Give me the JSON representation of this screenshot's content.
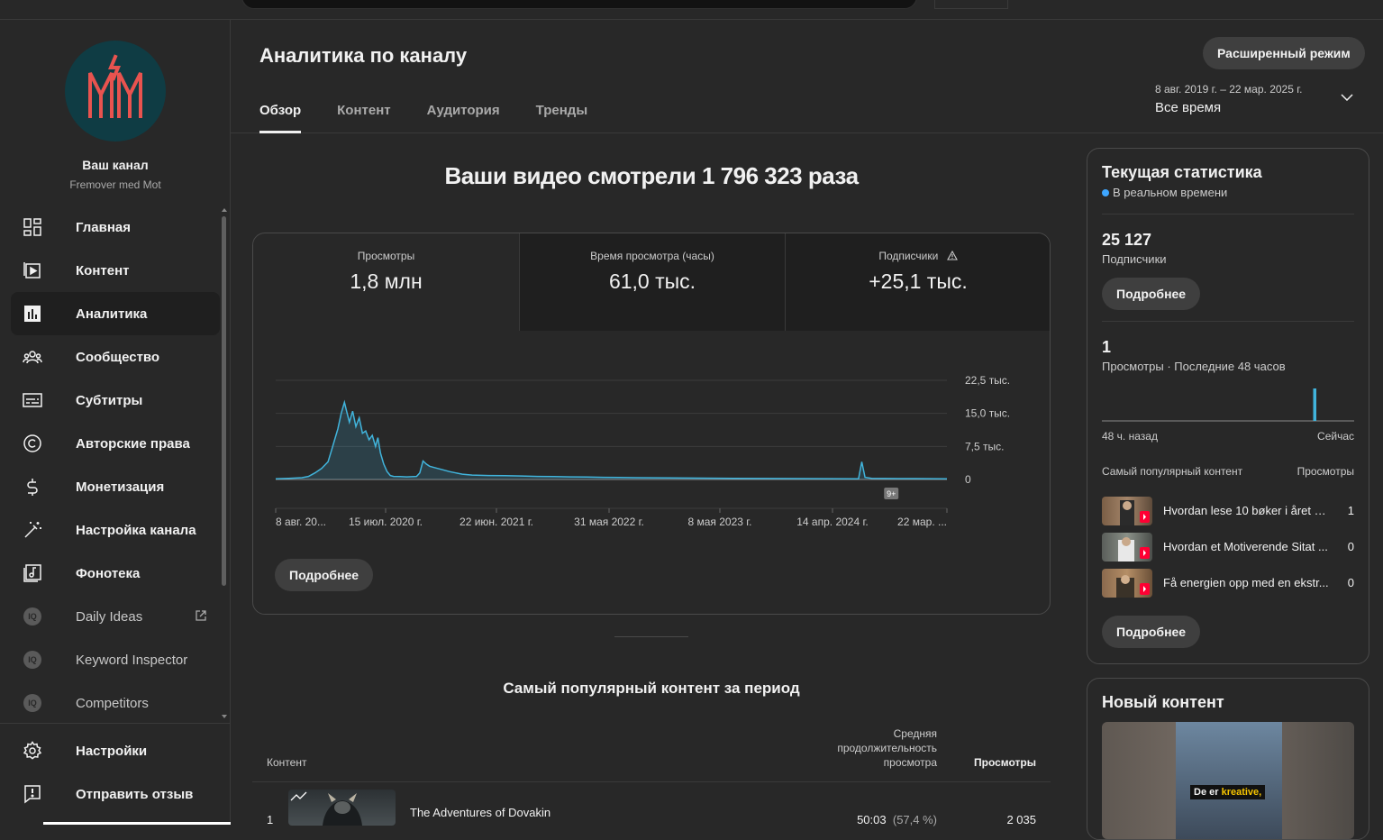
{
  "sidebar": {
    "channel_title": "Ваш канал",
    "channel_name": "Fremover med Mot",
    "items": [
      {
        "label": "Главная",
        "icon": "dashboard-icon"
      },
      {
        "label": "Контент",
        "icon": "content-icon"
      },
      {
        "label": "Аналитика",
        "icon": "analytics-icon",
        "active": true
      },
      {
        "label": "Сообщество",
        "icon": "community-icon"
      },
      {
        "label": "Субтитры",
        "icon": "subtitles-icon"
      },
      {
        "label": "Авторские права",
        "icon": "copyright-icon"
      },
      {
        "label": "Монетизация",
        "icon": "dollar-icon"
      },
      {
        "label": "Настройка канала",
        "icon": "magic-wand-icon"
      },
      {
        "label": "Фонотека",
        "icon": "audio-library-icon"
      }
    ],
    "extensions": [
      {
        "label": "Daily Ideas",
        "badge": "IQ",
        "external": true
      },
      {
        "label": "Keyword Inspector",
        "badge": "IQ"
      },
      {
        "label": "Competitors",
        "badge": "IQ"
      }
    ],
    "bottom": [
      {
        "label": "Настройки",
        "icon": "gear-icon"
      },
      {
        "label": "Отправить отзыв",
        "icon": "feedback-icon"
      }
    ]
  },
  "header": {
    "title": "Аналитика по каналу",
    "advanced_button": "Расширенный режим",
    "tabs": [
      "Обзор",
      "Контент",
      "Аудитория",
      "Тренды"
    ],
    "active_tab": "Обзор",
    "date_range": "8 авг. 2019 г. – 22 мар. 2025 г.",
    "date_preset": "Все время"
  },
  "overview": {
    "headline": "Ваши видео смотрели 1 796 323 раза",
    "metrics": [
      {
        "label": "Просмотры",
        "value": "1,8 млн"
      },
      {
        "label": "Время просмотра (часы)",
        "value": "61,0 тыс."
      },
      {
        "label": "Подписчики",
        "value": "+25,1 тыс.",
        "warning": true
      }
    ],
    "more_button": "Подробнее",
    "event_badge": "9+"
  },
  "chart_data": {
    "type": "line",
    "title": "",
    "x_tick_labels": [
      "8 авг. 20...",
      "15 июл. 2020 г.",
      "22 июн. 2021 г.",
      "31 мая 2022 г.",
      "8 мая 2023 г.",
      "14 апр. 2024 г.",
      "22 мар. ..."
    ],
    "y_tick_labels": [
      "0",
      "7,5 тыс.",
      "15,0 тыс.",
      "22,5 тыс."
    ],
    "ylim": [
      0,
      22500
    ],
    "x_range": [
      0,
      2050
    ],
    "grid": true,
    "color": "#41b4dc",
    "points": [
      [
        0,
        150
      ],
      [
        40,
        250
      ],
      [
        80,
        400
      ],
      [
        100,
        700
      ],
      [
        120,
        1500
      ],
      [
        140,
        2500
      ],
      [
        160,
        4000
      ],
      [
        170,
        6500
      ],
      [
        180,
        9000
      ],
      [
        190,
        11500
      ],
      [
        200,
        15000
      ],
      [
        210,
        17500
      ],
      [
        215,
        16000
      ],
      [
        225,
        13000
      ],
      [
        235,
        15500
      ],
      [
        245,
        12000
      ],
      [
        255,
        14000
      ],
      [
        265,
        10500
      ],
      [
        275,
        11000
      ],
      [
        285,
        9000
      ],
      [
        295,
        10000
      ],
      [
        305,
        7500
      ],
      [
        312,
        9500
      ],
      [
        320,
        6000
      ],
      [
        330,
        3500
      ],
      [
        340,
        1800
      ],
      [
        350,
        900
      ],
      [
        360,
        700
      ],
      [
        380,
        650
      ],
      [
        400,
        600
      ],
      [
        430,
        700
      ],
      [
        440,
        1500
      ],
      [
        450,
        4200
      ],
      [
        460,
        3500
      ],
      [
        470,
        3000
      ],
      [
        490,
        2600
      ],
      [
        510,
        2200
      ],
      [
        530,
        1800
      ],
      [
        550,
        1500
      ],
      [
        570,
        1200
      ],
      [
        600,
        1000
      ],
      [
        650,
        900
      ],
      [
        700,
        850
      ],
      [
        750,
        800
      ],
      [
        800,
        700
      ],
      [
        850,
        650
      ],
      [
        900,
        600
      ],
      [
        950,
        550
      ],
      [
        1000,
        500
      ],
      [
        1050,
        450
      ],
      [
        1100,
        400
      ],
      [
        1150,
        380
      ],
      [
        1200,
        350
      ],
      [
        1250,
        320
      ],
      [
        1300,
        300
      ],
      [
        1400,
        250
      ],
      [
        1500,
        220
      ],
      [
        1600,
        200
      ],
      [
        1700,
        180
      ],
      [
        1780,
        160
      ],
      [
        1790,
        4000
      ],
      [
        1800,
        500
      ],
      [
        1820,
        250
      ],
      [
        1900,
        200
      ],
      [
        2000,
        180
      ],
      [
        2050,
        150
      ]
    ]
  },
  "top_content": {
    "title": "Самый популярный контент за период",
    "col_content": "Контент",
    "col_duration": "Средняя продолжительность просмотра",
    "col_views": "Просмотры",
    "rows": [
      {
        "rank": "1",
        "title": "The Adventures of Dovakin",
        "duration": "50:03",
        "duration_pct": "(57,4 %)",
        "views": "2 035"
      }
    ]
  },
  "realtime": {
    "title": "Текущая статистика",
    "subtitle": "В реальном времени",
    "subscribers_value": "25 127",
    "subscribers_label": "Подписчики",
    "more_button": "Подробнее",
    "views_value": "1",
    "views_label": "Просмотры · Последние 48 часов",
    "bars": [
      0,
      0,
      0,
      0,
      0,
      0,
      0,
      0,
      0,
      0,
      0,
      0,
      0,
      0,
      0,
      0,
      0,
      0,
      0,
      0,
      0,
      0,
      0,
      0,
      0,
      0,
      0,
      0,
      0,
      0,
      0,
      0,
      0,
      0,
      0,
      0,
      0,
      0,
      0,
      0,
      1,
      0,
      0,
      0,
      0,
      0,
      0,
      0
    ],
    "axis_left": "48 ч. назад",
    "axis_right": "Сейчас",
    "popular_header": "Самый популярный контент",
    "popular_views_header": "Просмотры",
    "popular": [
      {
        "title": "Hvordan lese 10 bøker i året n...",
        "views": "1"
      },
      {
        "title": "Hvordan et Motiverende Sitat ...",
        "views": "0"
      },
      {
        "title": "Få energien opp med en ekstr...",
        "views": "0"
      }
    ]
  },
  "new_content": {
    "title": "Новый контент",
    "caption_a": "De er ",
    "caption_b": "kreative,"
  }
}
